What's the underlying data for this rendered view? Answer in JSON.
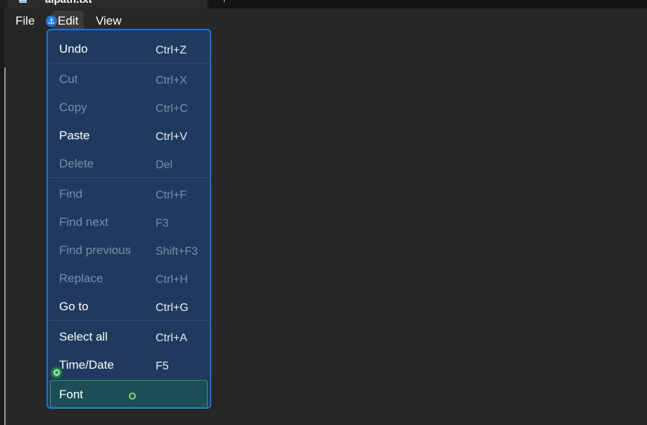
{
  "window": {
    "title": "aipath.txt"
  },
  "menubar": {
    "items": [
      {
        "label": "File"
      },
      {
        "label": "Edit"
      },
      {
        "label": "View"
      }
    ]
  },
  "edit_menu": {
    "items": [
      {
        "label": "Undo",
        "shortcut": "Ctrl+Z",
        "enabled": true
      },
      {
        "label": "Cut",
        "shortcut": "Ctrl+X",
        "enabled": false
      },
      {
        "label": "Copy",
        "shortcut": "Ctrl+C",
        "enabled": false
      },
      {
        "label": "Paste",
        "shortcut": "Ctrl+V",
        "enabled": true
      },
      {
        "label": "Delete",
        "shortcut": "Del",
        "enabled": false
      },
      {
        "label": "Find",
        "shortcut": "Ctrl+F",
        "enabled": false
      },
      {
        "label": "Find next",
        "shortcut": "F3",
        "enabled": false
      },
      {
        "label": "Find previous",
        "shortcut": "Shift+F3",
        "enabled": false
      },
      {
        "label": "Replace",
        "shortcut": "Ctrl+H",
        "enabled": false
      },
      {
        "label": "Go to",
        "shortcut": "Ctrl+G",
        "enabled": true
      },
      {
        "label": "Select all",
        "shortcut": "Ctrl+A",
        "enabled": true
      },
      {
        "label": "Time/Date",
        "shortcut": "F5",
        "enabled": true
      },
      {
        "label": "Font",
        "shortcut": "",
        "enabled": true,
        "highlighted": true
      }
    ]
  },
  "icons": {
    "anchor_badge": "anchor-icon",
    "target_badge": "target-icon",
    "document": "notepad-document-icon"
  },
  "colors": {
    "background": "#272727",
    "menu_background": "#1f3a5e",
    "menu_border": "#1c74d8",
    "highlight_background": "#1d4e57",
    "highlight_border": "#2aa36a",
    "disabled_text": "#7a8da8"
  }
}
